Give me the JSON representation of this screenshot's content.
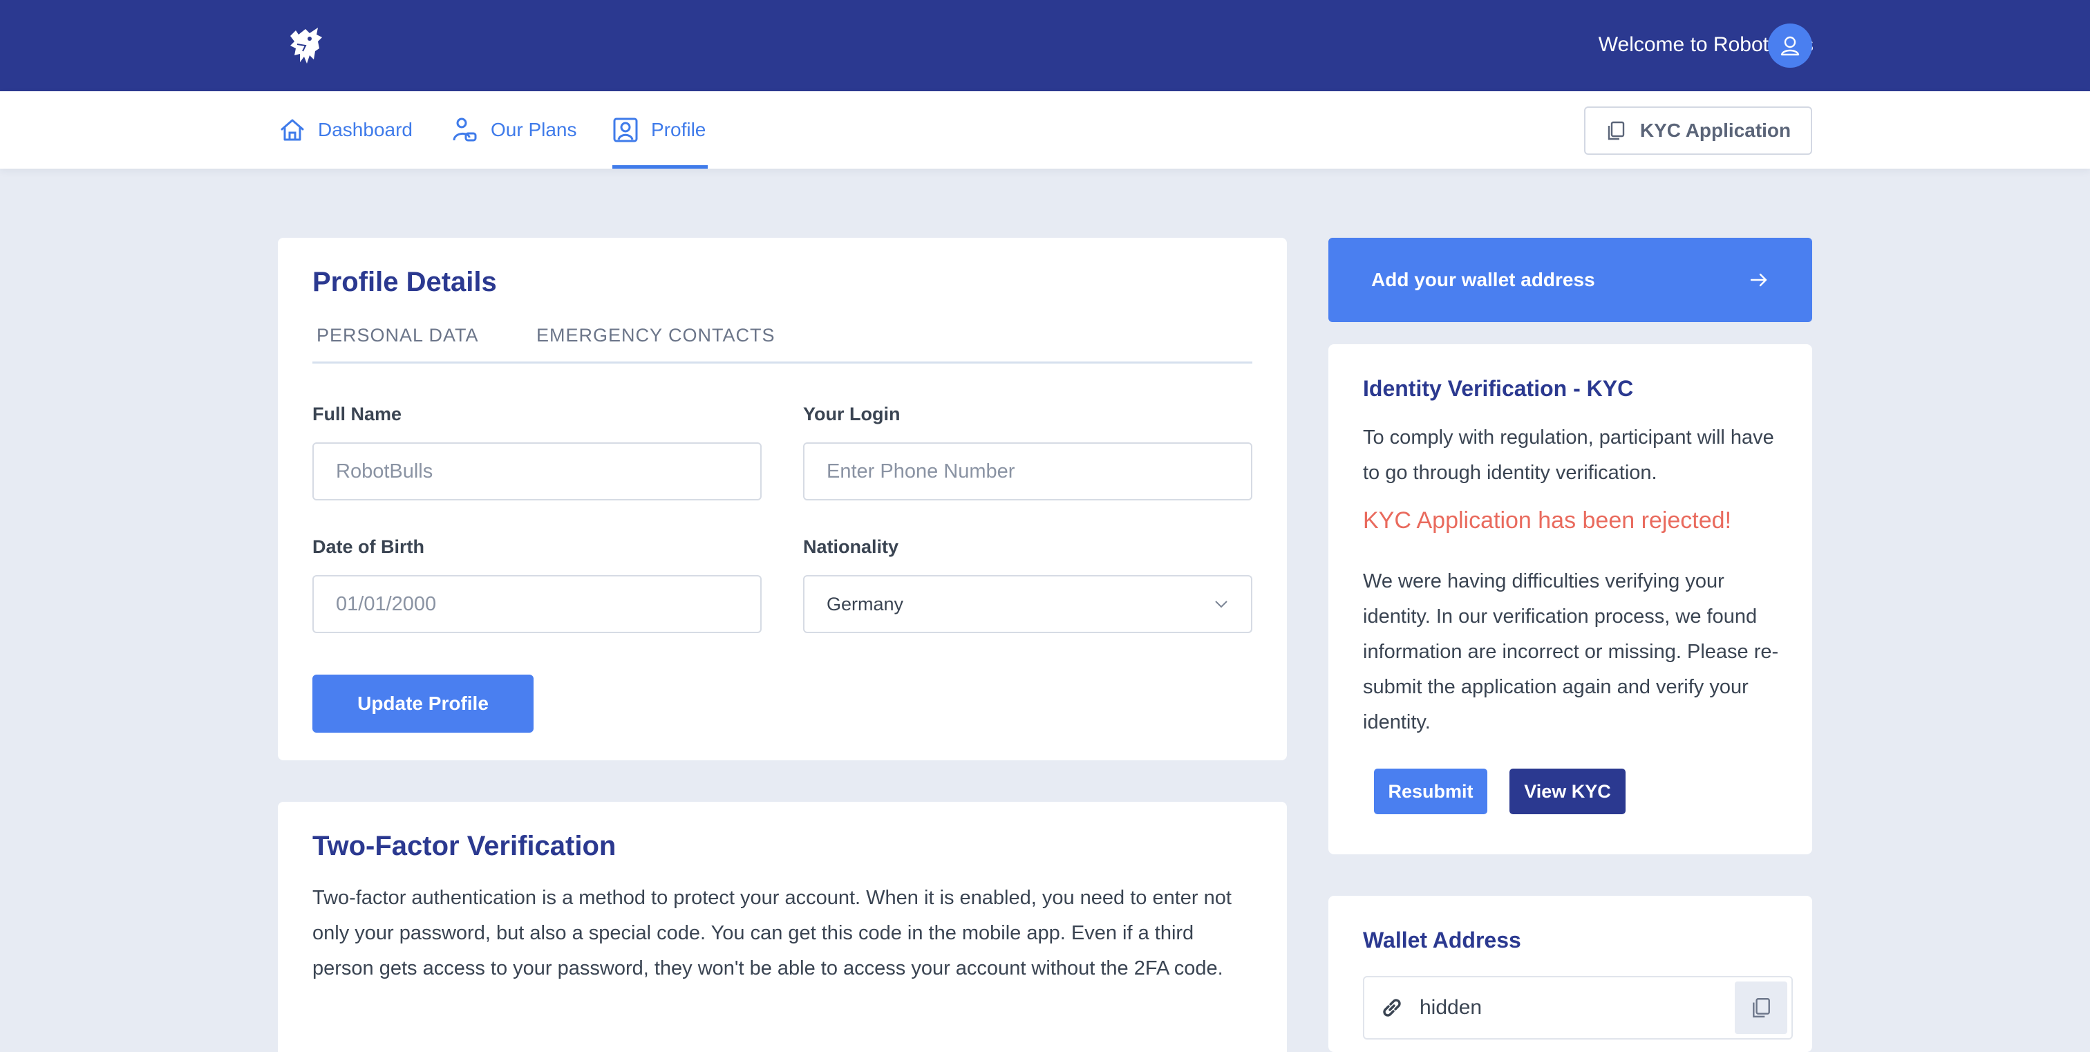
{
  "header": {
    "welcome_text": "Welcome to RobotBulls",
    "logo_icon": "bull-logo-icon",
    "avatar_icon": "user-icon"
  },
  "nav": {
    "items": [
      {
        "label": "Dashboard",
        "icon": "home-icon"
      },
      {
        "label": "Our Plans",
        "icon": "plans-icon"
      },
      {
        "label": "Profile",
        "icon": "profile-icon",
        "active": true
      }
    ],
    "kyc_button": "KYC Application"
  },
  "profile": {
    "title": "Profile Details",
    "tabs": [
      "PERSONAL DATA",
      "EMERGENCY CONTACTS"
    ],
    "full_name_label": "Full Name",
    "full_name_value": "RobotBulls",
    "login_label": "Your Login",
    "login_placeholder": "Enter Phone Number",
    "dob_label": "Date of Birth",
    "dob_value": "01/01/2000",
    "nationality_label": "Nationality",
    "nationality_value": "Germany",
    "update_button": "Update Profile"
  },
  "twofa": {
    "title": "Two-Factor Verification",
    "text": "Two-factor authentication is a method to protect your account. When it is enabled, you need to enter not only your password, but also a special code. You can get this code in the mobile app. Even if a third person gets access to your password, they won't be able to access your account without the 2FA code."
  },
  "wallet_banner": {
    "label": "Add your wallet address"
  },
  "kyc": {
    "title": "Identity Verification - KYC",
    "description": "To comply with regulation, participant will have to go through identity verification.",
    "status": "KYC Application has been rejected!",
    "detail": "We were having difficulties verifying your identity. In our verification process, we found information are incorrect or missing. Please re-submit the application again and verify your identity.",
    "resubmit_button": "Resubmit",
    "view_button": "View KYC"
  },
  "wallet": {
    "title": "Wallet Address",
    "value": "hidden"
  },
  "colors": {
    "primary_dark": "#2b3990",
    "primary": "#4a7ff0",
    "error": "#e96a5d",
    "background": "#e7ebf3"
  }
}
